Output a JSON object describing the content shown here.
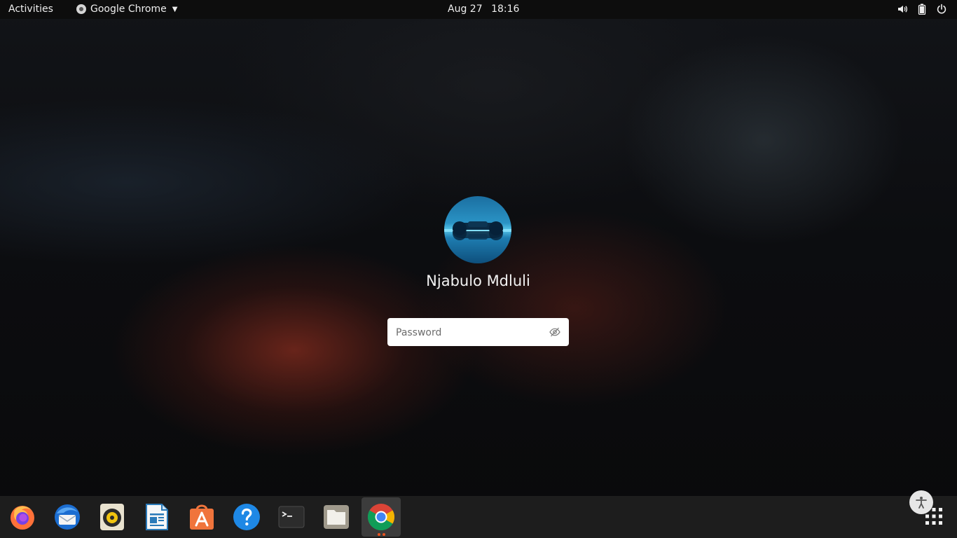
{
  "topbar": {
    "activities": "Activities",
    "app_name": "Google Chrome",
    "date": "Aug 27",
    "time": "18:16",
    "icons": [
      "chrome-icon",
      "dropdown-caret-icon",
      "volume-icon",
      "battery-icon",
      "power-icon"
    ]
  },
  "login": {
    "user_name": "Njabulo Mdluli",
    "password_placeholder": "Password",
    "icons": [
      "user-avatar",
      "hide-password-icon"
    ]
  },
  "dock": {
    "apps": [
      "firefox-icon",
      "thunderbird-icon",
      "rhythmbox-icon",
      "libreoffice-writer-icon",
      "ubuntu-software-icon",
      "help-icon",
      "terminal-icon",
      "files-icon",
      "chrome-icon"
    ],
    "active_app": "chrome-icon",
    "icons": [
      "show-applications-icon",
      "accessibility-icon"
    ]
  },
  "colors": {
    "accent": "#e95420",
    "topbar": "#0d0d0d",
    "dock": "#1d1d1d"
  }
}
